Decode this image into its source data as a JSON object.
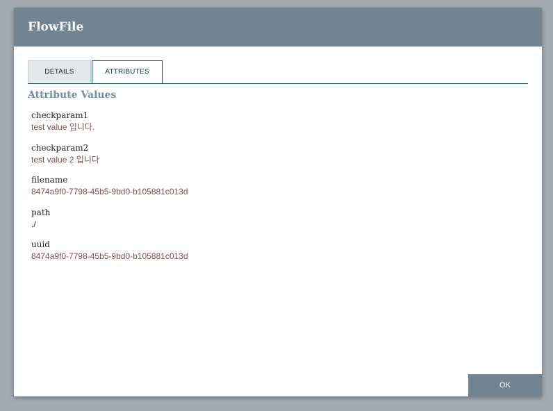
{
  "dialog": {
    "title": "FlowFile"
  },
  "tabs": [
    {
      "label": "DETAILS",
      "active": false
    },
    {
      "label": "ATTRIBUTES",
      "active": true
    }
  ],
  "section": {
    "title": "Attribute Values"
  },
  "attributes": [
    {
      "name": "checkparam1",
      "value": "test value 입니다."
    },
    {
      "name": "checkparam2",
      "value": "test value 2 입니다"
    },
    {
      "name": "filename",
      "value": "8474a9f0-7798-45b5-9bd0-b105881c013d"
    },
    {
      "name": "path",
      "value": "./"
    },
    {
      "name": "uuid",
      "value": "8474a9f0-7798-45b5-9bd0-b105881c013d"
    }
  ],
  "buttons": {
    "ok_label": "OK"
  },
  "colors": {
    "header": "#728492",
    "tab_active_border": "#004849",
    "section_title": "#728e9b",
    "value_text": "#775351",
    "backdrop": "#a2abb3"
  }
}
